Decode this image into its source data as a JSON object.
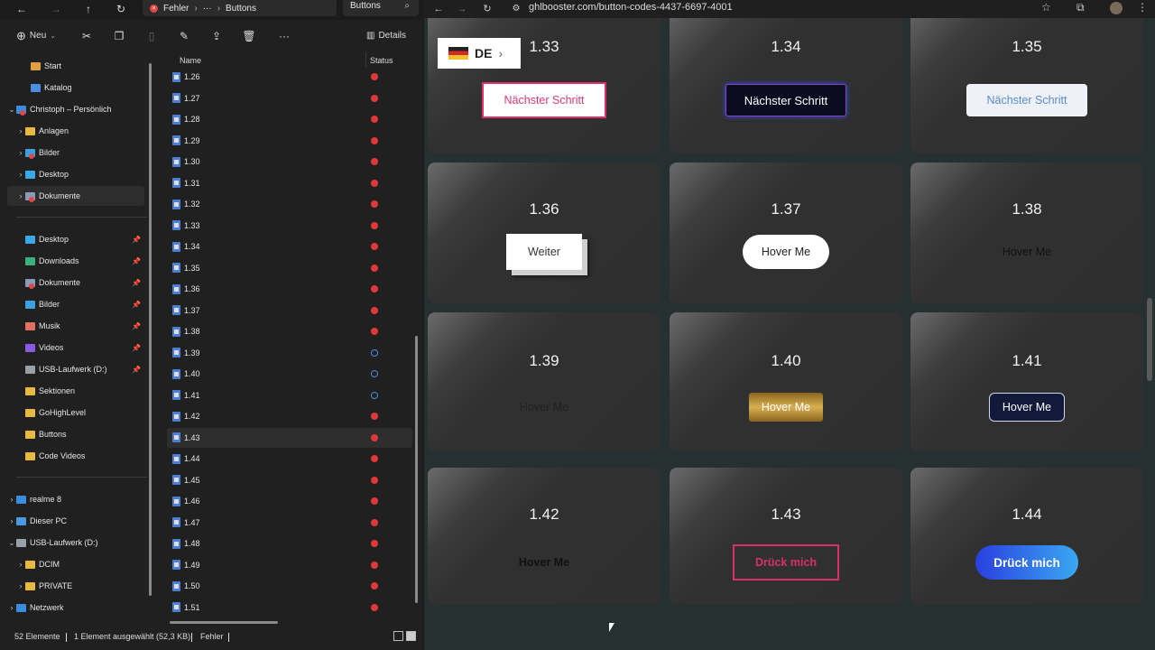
{
  "explorer": {
    "breadcrumb": {
      "current": "Fehler",
      "more": "···",
      "folder": "Buttons"
    },
    "search_placeholder": "Buttons",
    "toolbar": {
      "new_label": "Neu",
      "details_label": "Details"
    },
    "sidebar": {
      "top": [
        {
          "label": "Start",
          "icon": "home-icon"
        },
        {
          "label": "Katalog",
          "icon": "gallery-icon"
        },
        {
          "label": "Christoph – Persönlich",
          "icon": "onedrive-icon"
        },
        {
          "label": "Anlagen",
          "icon": "folder-icon"
        },
        {
          "label": "Bilder",
          "icon": "pictures-icon"
        },
        {
          "label": "Desktop",
          "icon": "desktop-icon"
        },
        {
          "label": "Dokumente",
          "icon": "documents-icon"
        }
      ],
      "pinned": [
        {
          "label": "Desktop",
          "icon": "desktop-icon"
        },
        {
          "label": "Downloads",
          "icon": "download-icon"
        },
        {
          "label": "Dokumente",
          "icon": "documents-icon"
        },
        {
          "label": "Bilder",
          "icon": "pictures-icon"
        },
        {
          "label": "Musik",
          "icon": "music-icon"
        },
        {
          "label": "Videos",
          "icon": "videos-icon"
        },
        {
          "label": "USB-Laufwerk (D:)",
          "icon": "usb-icon"
        },
        {
          "label": "Sektionen",
          "icon": "folder-icon"
        },
        {
          "label": "GoHighLevel",
          "icon": "folder-icon"
        },
        {
          "label": "Buttons",
          "icon": "folder-icon"
        },
        {
          "label": "Code Videos",
          "icon": "folder-icon"
        }
      ],
      "devices": [
        {
          "label": "realme 8",
          "icon": "phone-icon"
        },
        {
          "label": "Dieser PC",
          "icon": "pc-icon"
        },
        {
          "label": "USB-Laufwerk (D:)",
          "icon": "usb-icon"
        },
        {
          "label": "DCIM",
          "icon": "folder-icon"
        },
        {
          "label": "PRIVATE",
          "icon": "folder-icon"
        },
        {
          "label": "Netzwerk",
          "icon": "network-icon"
        }
      ]
    },
    "columns": {
      "name": "Name",
      "status": "Status"
    },
    "files": [
      {
        "name": "1.26",
        "status": "error"
      },
      {
        "name": "1.27",
        "status": "error"
      },
      {
        "name": "1.28",
        "status": "error"
      },
      {
        "name": "1.29",
        "status": "error"
      },
      {
        "name": "1.30",
        "status": "error"
      },
      {
        "name": "1.31",
        "status": "error"
      },
      {
        "name": "1.32",
        "status": "error"
      },
      {
        "name": "1.33",
        "status": "error"
      },
      {
        "name": "1.34",
        "status": "error"
      },
      {
        "name": "1.35",
        "status": "error"
      },
      {
        "name": "1.36",
        "status": "error"
      },
      {
        "name": "1.37",
        "status": "error"
      },
      {
        "name": "1.38",
        "status": "error"
      },
      {
        "name": "1.39",
        "status": "sync"
      },
      {
        "name": "1.40",
        "status": "sync"
      },
      {
        "name": "1.41",
        "status": "sync"
      },
      {
        "name": "1.42",
        "status": "error"
      },
      {
        "name": "1.43",
        "status": "error"
      },
      {
        "name": "1.44",
        "status": "error"
      },
      {
        "name": "1.45",
        "status": "error"
      },
      {
        "name": "1.46",
        "status": "error"
      },
      {
        "name": "1.47",
        "status": "error"
      },
      {
        "name": "1.48",
        "status": "error"
      },
      {
        "name": "1.49",
        "status": "error"
      },
      {
        "name": "1.50",
        "status": "error"
      },
      {
        "name": "1.51",
        "status": "error"
      }
    ],
    "selected_file": "1.43",
    "status_bar": {
      "count": "52 Elemente",
      "selection": "1 Element ausgewählt (52,3 KB)",
      "state": "Fehler"
    }
  },
  "browser": {
    "url": "ghlbooster.com/button-codes-4437-6697-4001",
    "language": "DE",
    "cards": [
      {
        "num": "1.33",
        "button": "Nächster Schritt"
      },
      {
        "num": "1.34",
        "button": "Nächster Schritt"
      },
      {
        "num": "1.35",
        "button": "Nächster Schritt"
      },
      {
        "num": "1.36",
        "button": "Weiter"
      },
      {
        "num": "1.37",
        "button": "Hover Me"
      },
      {
        "num": "1.38",
        "button": "Hover Me"
      },
      {
        "num": "1.39",
        "button": "Hover Me"
      },
      {
        "num": "1.40",
        "button": "Hover Me"
      },
      {
        "num": "1.41",
        "button": "Hover Me"
      },
      {
        "num": "1.42",
        "button": "Hover Me"
      },
      {
        "num": "1.43",
        "button": "Drück mich"
      },
      {
        "num": "1.44",
        "button": "Drück mich"
      }
    ]
  },
  "colors": {
    "explorer_bg": "#202020",
    "error_red": "#e03838",
    "sync_blue": "#4a8fe0",
    "page_bg": "#273030",
    "pink_accent": "#e0306a",
    "gold": "#c49a3a",
    "blue_gradient_start": "#2a3fe0",
    "blue_gradient_end": "#3aa8f0"
  }
}
